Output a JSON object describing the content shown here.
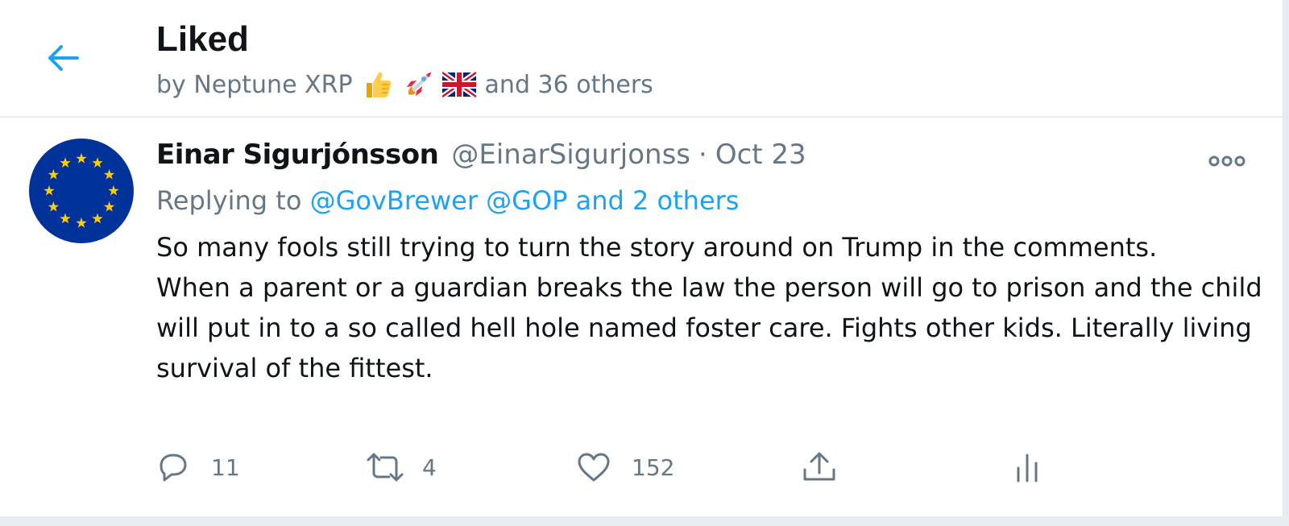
{
  "header": {
    "title": "Liked",
    "subtitle_prefix": "by Neptune XRP",
    "subtitle_emojis": [
      "thumbs-up-icon",
      "rocket-icon",
      "uk-flag-icon"
    ],
    "subtitle_suffix": "and 36 others"
  },
  "tweet": {
    "author_name": "Einar Sigurjónsson",
    "handle": "@EinarSigurjonss",
    "separator": "·",
    "date": "Oct 23",
    "replying_prefix": "Replying to",
    "replying_links": "@GovBrewer @GOP and 2 others",
    "body_line1": "So many fools still trying to turn the story around on Trump in the comments.",
    "body_line2": "When a parent or a guardian breaks the law the person will go to prison and the child will put in to a so called hell hole named foster care. Fights other kids. Literally living survival of the fittest.",
    "replies": "11",
    "retweets": "4",
    "likes": "152"
  },
  "colors": {
    "accent": "#1da1f2",
    "muted": "#657786",
    "text": "#0f1419",
    "eu_blue": "#003399",
    "eu_star": "#ffcc00"
  }
}
